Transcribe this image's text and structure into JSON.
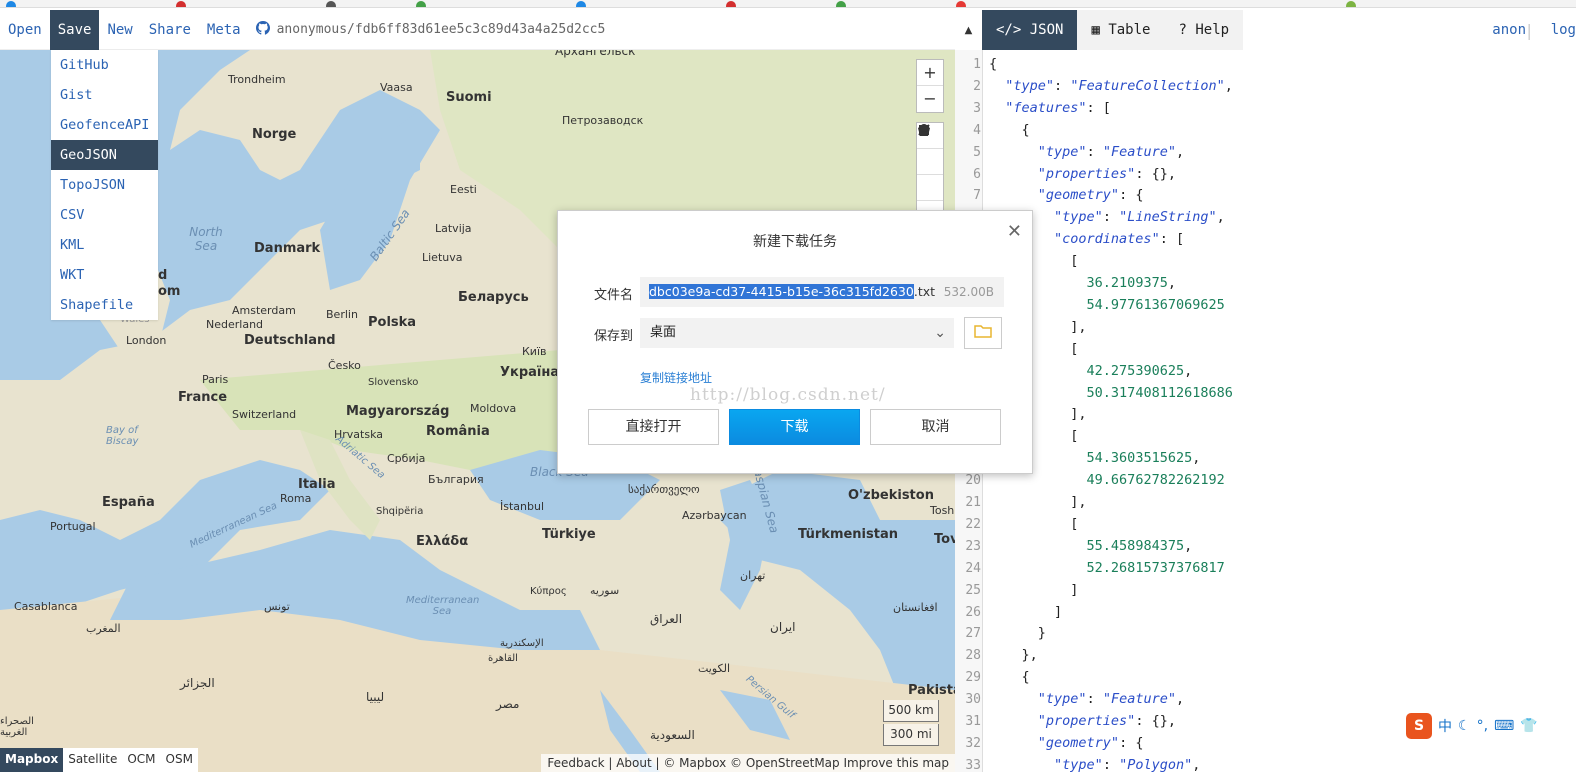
{
  "toolbar": {
    "open": "Open",
    "save": "Save",
    "new": "New",
    "share": "Share",
    "meta": "Meta",
    "gist_id": "anonymous/fdb6ff83d61ee5c3c89d43a4a25d2cc5"
  },
  "save_menu": [
    "GitHub",
    "Gist",
    "GeofenceAPI",
    "GeoJSON",
    "TopoJSON",
    "CSV",
    "KML",
    "WKT",
    "Shapefile"
  ],
  "save_menu_selected": "GeoJSON",
  "map": {
    "controls": {
      "search": "search-icon",
      "zoom_in": "+",
      "zoom_out": "−"
    },
    "layers": [
      "Mapbox",
      "Satellite",
      "OCM",
      "OSM"
    ],
    "active_layer": "Mapbox",
    "scale_km": "500 km",
    "scale_mi": "300 mi",
    "attribution": "Feedback | About | © Mapbox © OpenStreetMap Improve this map",
    "labels": {
      "arkhangelsk": "Архангельск",
      "trondheim": "Trondheim",
      "vaasa": "Vaasa",
      "suomi": "Suomi",
      "norge": "Norge",
      "petrozavodsk": "Петрозаводск",
      "north_sea": "North Sea",
      "eesti": "Eesti",
      "baltic_sea": "Baltic Sea",
      "danmark": "Danmark",
      "latvija": "Latvija",
      "lietuva": "Lietuva",
      "belarus": "Беларусь",
      "amsterdam": "Amsterdam",
      "berlin": "Berlin",
      "nederland": "Nederland",
      "polska": "Polska",
      "deutschland": "Deutschland",
      "london": "London",
      "kyiv": "Київ",
      "cesko": "Česko",
      "paris": "Paris",
      "slovensko": "Slovensko",
      "ukraina": "Україна",
      "france": "France",
      "moldova": "Moldova",
      "switzerland": "Switzerland",
      "magyarorszag": "Magyarország",
      "bay_of_biscay": "Bay of Biscay",
      "hrvatska": "Hrvatska",
      "romania": "România",
      "srbija": "Србија",
      "adriatic_sea": "Adriatic Sea",
      "black_sea": "Black Sea",
      "bulgaria": "България",
      "italia": "Italia",
      "georgia": "საქართველო",
      "caspian_sea": "Caspian Sea",
      "espana": "España",
      "roma": "Roma",
      "shqiperia": "Shqipëria",
      "istanbul": "İstanbul",
      "azerbaycan": "Azərbaycan",
      "uzbekiston": "O'zbekiston",
      "portugal": "Portugal",
      "mediterranean_sea": "Mediterranean Sea",
      "ellada": "Ελλάδα",
      "turkiye": "Türkiye",
      "turkmenistan": "Türkmenistan",
      "tehran": "تهران",
      "kypros": "Κύπρος",
      "syria": "سوريه",
      "casablanca": "Casablanca",
      "tunis": "تونس",
      "mediterranean_sea_2": "Mediterranean Sea",
      "iraq": "العراق",
      "iran": "ایران",
      "afghanistan": "افغانستان",
      "maghrib": "المغرب",
      "iskandariya": "الإسكندرية",
      "qahira": "القاهرة",
      "kuwait": "الكويت",
      "jazair": "الجزائر",
      "libya": "ليبيا",
      "misr": "مصر",
      "persian_gulf": "Persian Gulf",
      "pakistan": "Pakista",
      "saudia": "السعودية",
      "sahra": "الصحراء الغربية",
      "tosh": "Tosh",
      "tov": "Tov",
      "kingdom_d": "d",
      "kingdom_om": "om",
      "wales": "Wales"
    }
  },
  "dialog": {
    "title": "新建下载任务",
    "filename_label": "文件名",
    "filename_selected": "dbc03e9a-cd37-4415-b15e-36c315fd2630",
    "filename_ext": ".txt",
    "filesize": "532.00B",
    "saveto_label": "保存到",
    "saveto_value": "桌面",
    "copy_link": "复制链接地址",
    "watermark": "http://blog.csdn.net/",
    "open_btn": "直接打开",
    "download_btn": "下载",
    "cancel_btn": "取消"
  },
  "right_panel": {
    "tabs": [
      "JSON",
      "Table",
      "Help"
    ],
    "active_tab": "JSON",
    "user": "anon",
    "login": "log"
  },
  "code_lines": [
    "{",
    "  \"type\": \"FeatureCollection\",",
    "  \"features\": [",
    "    {",
    "      \"type\": \"Feature\",",
    "      \"properties\": {},",
    "      \"geometry\": {",
    "        \"type\": \"LineString\",",
    "        \"coordinates\": [",
    "          [",
    "            36.2109375,",
    "            54.97761367069625",
    "          ],",
    "          [",
    "            42.275390625,",
    "            50.317408112618686",
    "          ],",
    "          [",
    "            54.3603515625,",
    "            49.66762782262192",
    "          ],",
    "          [",
    "            55.458984375,",
    "            52.26815737376817",
    "          ]",
    "        ]",
    "      }",
    "    },",
    "    {",
    "      \"type\": \"Feature\",",
    "      \"properties\": {},",
    "      \"geometry\": {",
    "        \"type\": \"Polygon\","
  ],
  "ime": {
    "lang": "中",
    "icons": "moon-icon punctuation-icon keyboard-icon shirt-icon"
  },
  "colors": {
    "dark": "#34495e",
    "link": "#2b63b3",
    "sea": "#a9cbe6",
    "land": "#e8e0cc",
    "primary_btn": "#0b8be0"
  }
}
